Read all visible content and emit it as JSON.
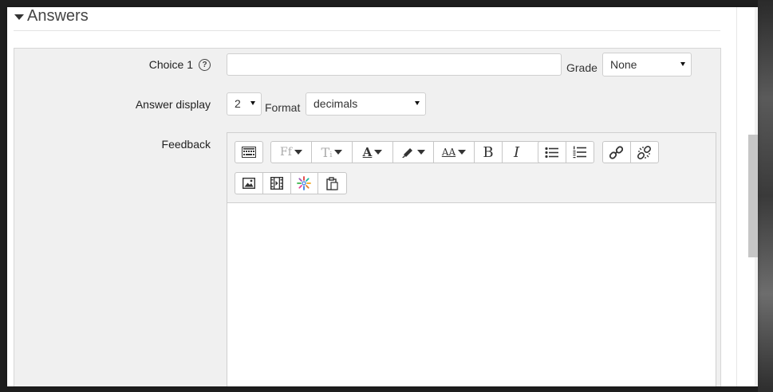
{
  "section": {
    "title": "Answers"
  },
  "choice": {
    "label": "Choice 1",
    "help_glyph": "?",
    "value": "",
    "grade_label": "Grade",
    "grade_value": "None"
  },
  "answer_display": {
    "label": "Answer display",
    "value": "2",
    "format_label": "Format",
    "format_value": "decimals"
  },
  "feedback": {
    "label": "Feedback",
    "toolbar_row1": [
      {
        "name": "toolbar-toggle-button",
        "icon": "keyboard-icon"
      },
      {
        "name": "font-family-button",
        "icon": "font-family-icon",
        "glyph": "Ff"
      },
      {
        "name": "font-size-button",
        "icon": "font-size-icon",
        "glyph": "Tᵢ"
      },
      {
        "name": "font-color-button",
        "icon": "font-color-icon",
        "glyph": "A"
      },
      {
        "name": "background-color-button",
        "icon": "highlight-icon"
      },
      {
        "name": "paragraph-style-button",
        "icon": "style-icon",
        "glyph": "AA"
      },
      {
        "name": "bold-button",
        "icon": "bold-icon",
        "glyph": "B"
      },
      {
        "name": "italic-button",
        "icon": "italic-icon",
        "glyph": "I"
      },
      {
        "name": "unordered-list-button",
        "icon": "bullet-list-icon"
      },
      {
        "name": "ordered-list-button",
        "icon": "numbered-list-icon"
      },
      {
        "name": "link-button",
        "icon": "link-icon"
      },
      {
        "name": "unlink-button",
        "icon": "unlink-icon"
      }
    ],
    "toolbar_row2": [
      {
        "name": "insert-image-button",
        "icon": "image-icon"
      },
      {
        "name": "insert-media-button",
        "icon": "film-icon"
      },
      {
        "name": "manage-files-button",
        "icon": "sparkle-icon"
      },
      {
        "name": "paste-button",
        "icon": "clipboard-icon"
      }
    ],
    "content": ""
  }
}
